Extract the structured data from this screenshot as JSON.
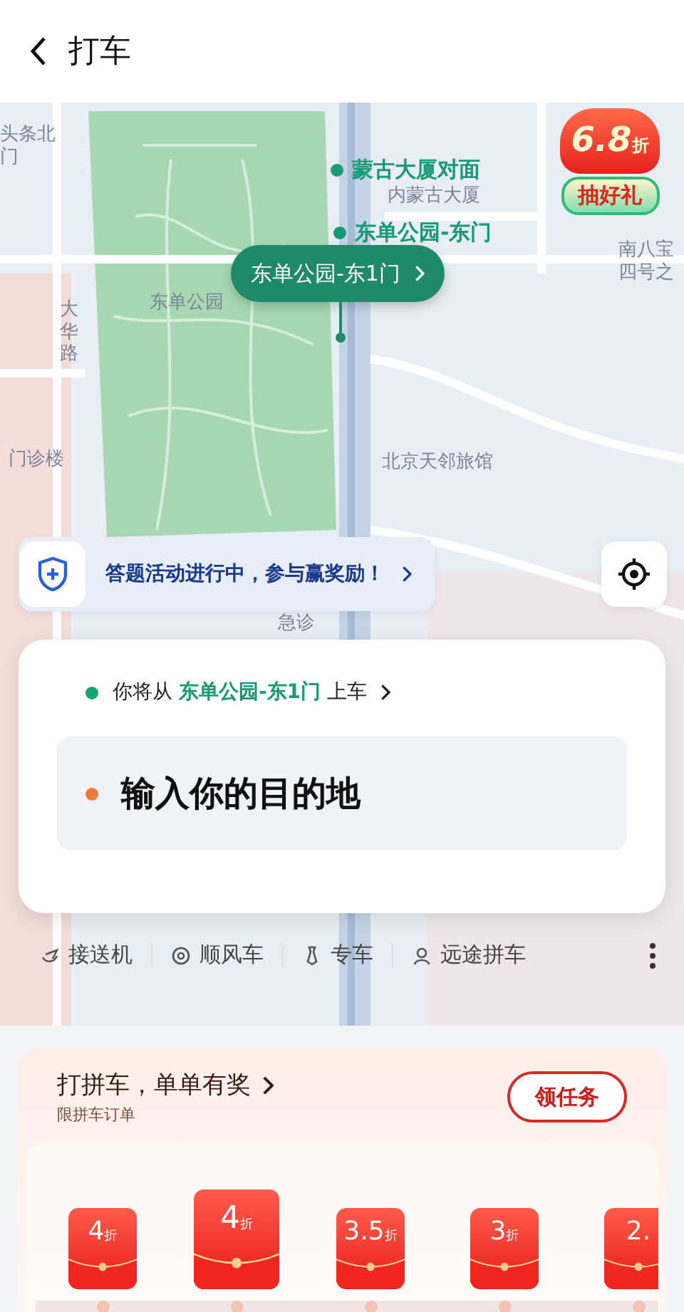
{
  "header": {
    "title": "打车"
  },
  "map": {
    "labels": [
      "头条北门",
      "大华路",
      "东单公园",
      "内蒙古大厦",
      "北京天邻旅馆",
      "门诊楼",
      "急诊",
      "南八宝四号之"
    ],
    "stops": [
      {
        "name": "蒙古大厦对面"
      },
      {
        "name": "东单公园-东门"
      }
    ],
    "pickup_bubble": "东单公园-东1门"
  },
  "promo": {
    "discount": "6.8",
    "unit": "折",
    "label": "抽好礼"
  },
  "activity_banner": {
    "text": "答题活动进行中，参与赢奖励！"
  },
  "trip_card": {
    "from_prefix": "你将从",
    "from_place": "东单公园-东1门",
    "from_suffix": "上车",
    "destination_placeholder": "输入你的目的地"
  },
  "services": [
    {
      "label": "接送机"
    },
    {
      "label": "顺风车"
    },
    {
      "label": "专车"
    },
    {
      "label": "远途拼车"
    }
  ],
  "carpool_section": {
    "title": "打拼车，单单有奖",
    "subtitle": "限拼车订单",
    "button": "领任务",
    "packets": [
      {
        "value": "4",
        "unit": "折",
        "selected": false
      },
      {
        "value": "4",
        "unit": "折",
        "selected": true
      },
      {
        "value": "3.5",
        "unit": "折",
        "selected": false
      },
      {
        "value": "3",
        "unit": "折",
        "selected": false
      },
      {
        "value": "2.",
        "selected": false
      }
    ]
  }
}
